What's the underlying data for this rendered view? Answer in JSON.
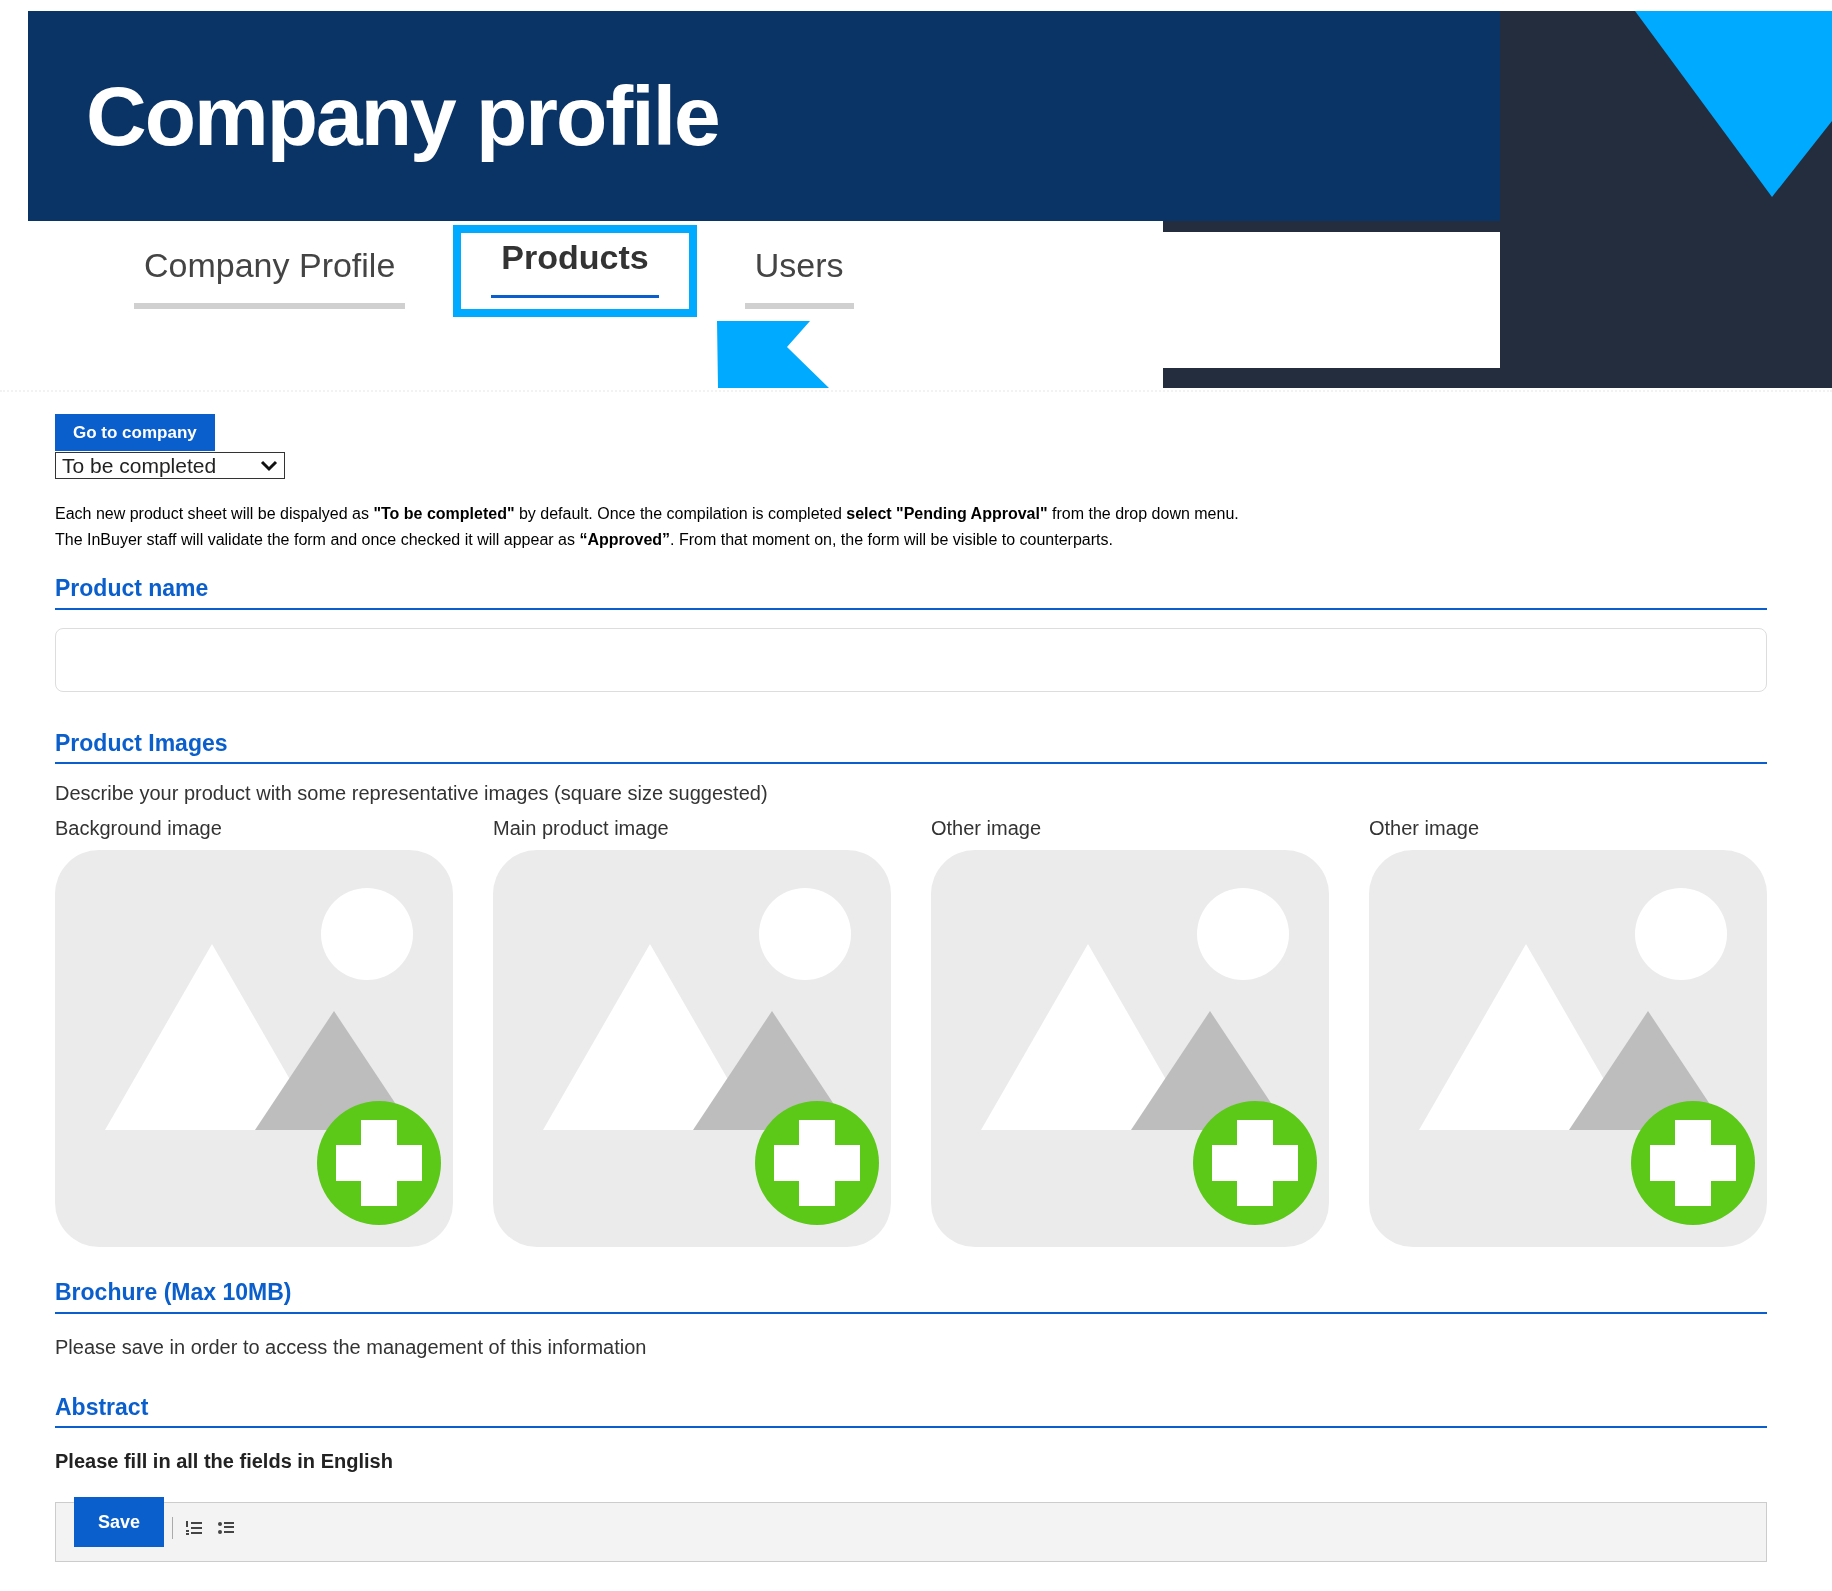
{
  "header": {
    "title": "Company profile"
  },
  "tabs": [
    {
      "label": "Company Profile",
      "selected": false
    },
    {
      "label": "Products",
      "selected": true
    },
    {
      "label": "Users",
      "selected": false
    }
  ],
  "go_to_company_button": "Go to company",
  "status_select": {
    "value": "To be completed"
  },
  "info_text": [
    "Each new product sheet will be dispalyed as **\"To be completed\"** by default. Once the compilation is completed **select \"Pending Approval\"** from the drop down menu.",
    "The InBuyer staff will validate the form and once checked it will appear as **“Approved”**. From that moment on, the form will be visible to counterparts."
  ],
  "product_name": {
    "heading": "Product name"
  },
  "product_images": {
    "heading": "Product Images",
    "description": "Describe your product with some representative images (square size suggested)",
    "images": [
      {
        "label": "Background image"
      },
      {
        "label": "Main product image"
      },
      {
        "label": "Other image"
      },
      {
        "label": "Other image"
      }
    ]
  },
  "brochure": {
    "heading": "Brochure (Max 10MB)",
    "note": "Please save in order to access the management of this information"
  },
  "abstract": {
    "heading": "Abstract",
    "note": "Please fill in all the fields in English",
    "save_button": "Save"
  }
}
